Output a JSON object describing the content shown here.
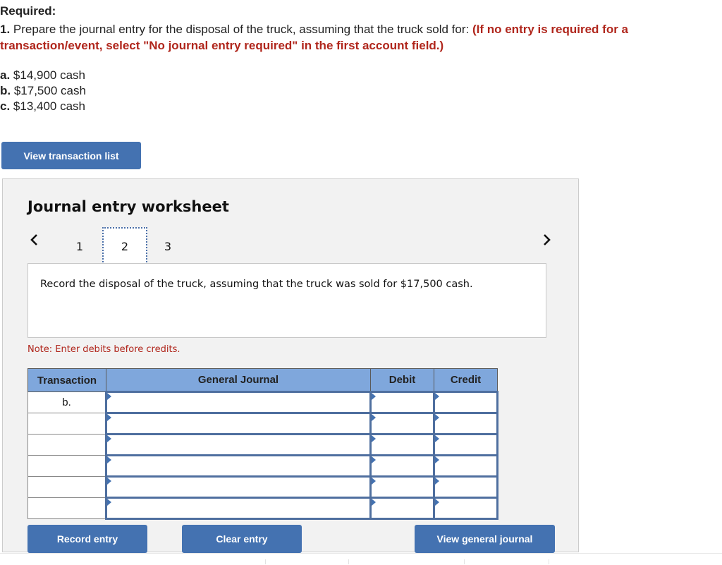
{
  "required": {
    "label": "Required:",
    "number": "1.",
    "instruction": " Prepare the journal entry for the disposal of the truck, assuming that the truck sold for: ",
    "note": "(If no entry is required for a transaction/event, select \"No journal entry required\" in the first account field.)"
  },
  "options": [
    {
      "letter": "a.",
      "text": " $14,900 cash"
    },
    {
      "letter": "b.",
      "text": " $17,500 cash"
    },
    {
      "letter": "c.",
      "text": " $13,400 cash"
    }
  ],
  "buttons": {
    "view_transaction_list": "View transaction list",
    "record_entry": "Record entry",
    "clear_entry": "Clear entry",
    "view_general_journal": "View general journal"
  },
  "worksheet": {
    "title": "Journal entry worksheet",
    "prev_icon": "‹",
    "next_icon": "›",
    "tabs": [
      "1",
      "2",
      "3"
    ],
    "active_tab": "2",
    "description": "Record the disposal of the truck, assuming that the truck was sold for $17,500 cash.",
    "note": "Note: Enter debits before credits.",
    "table": {
      "headers": [
        "Transaction",
        "General Journal",
        "Debit",
        "Credit"
      ],
      "rows": [
        {
          "transaction": "b.",
          "account": "",
          "debit": "",
          "credit": ""
        },
        {
          "transaction": "",
          "account": "",
          "debit": "",
          "credit": ""
        },
        {
          "transaction": "",
          "account": "",
          "debit": "",
          "credit": ""
        },
        {
          "transaction": "",
          "account": "",
          "debit": "",
          "credit": ""
        },
        {
          "transaction": "",
          "account": "",
          "debit": "",
          "credit": ""
        },
        {
          "transaction": "",
          "account": "",
          "debit": "",
          "credit": ""
        }
      ]
    }
  },
  "colors": {
    "accent_button": "#4472b1",
    "header_blue": "#7fa7dc",
    "instruction_red": "#b0261c",
    "panel_bg": "#f2f2f2"
  }
}
